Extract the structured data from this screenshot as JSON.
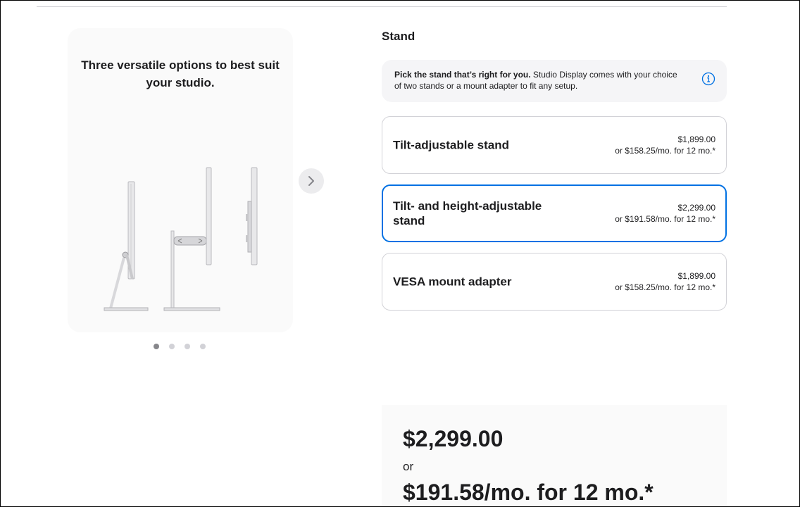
{
  "gallery": {
    "caption": "Three versatile options to best suit your studio.",
    "dots": 4,
    "active_dot": 0,
    "next_icon": "chevron-right-icon"
  },
  "stand": {
    "title": "Stand",
    "info": {
      "bold": "Pick the stand that’s right for you.",
      "text": " Studio Display comes with your choice of two stands or a mount adapter to fit any setup.",
      "icon": "info-icon"
    },
    "options": [
      {
        "name": "Tilt-adjustable stand",
        "price": "$1,899.00",
        "monthly": "or $158.25/mo. for 12 mo.*",
        "selected": false
      },
      {
        "name": "Tilt- and height-adjustable stand",
        "price": "$2,299.00",
        "monthly": "or $191.58/mo. for 12 mo.*",
        "selected": true
      },
      {
        "name": "VESA mount adapter",
        "price": "$1,899.00",
        "monthly": "or $158.25/mo. for 12 mo.*",
        "selected": false
      }
    ]
  },
  "summary": {
    "total": "$2,299.00",
    "or": "or",
    "monthly": "$191.58/mo. for 12 mo.*"
  },
  "colors": {
    "accent": "#0071e3",
    "card_bg": "#fafafa",
    "info_bg": "#f5f5f7",
    "border": "#d2d2d7"
  }
}
